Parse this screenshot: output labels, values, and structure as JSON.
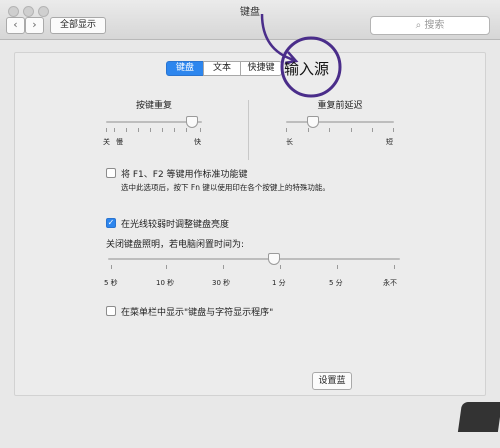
{
  "window": {
    "title": "键盘"
  },
  "toolbar": {
    "show_all": "全部显示",
    "search_placeholder": "搜索",
    "back": "‹",
    "forward": "›"
  },
  "tabs": [
    {
      "label": "键盘",
      "active": true
    },
    {
      "label": "文本",
      "active": false
    },
    {
      "label": "快捷键",
      "active": false
    }
  ],
  "annotation": {
    "text": "输入源",
    "color": "#4a2d8a"
  },
  "key_repeat": {
    "title": "按键重复",
    "min_label": "关",
    "slow_label": "慢",
    "fast_label": "快",
    "level": 0.9
  },
  "delay_until_repeat": {
    "title": "重复前延迟",
    "long_label": "长",
    "short_label": "短",
    "level": 0.25
  },
  "fn_keys": {
    "checked": false,
    "label": "将 F1、F2 等键用作标准功能键",
    "description": "选中此选项后，按下 Fn 键以使用印在各个按键上的特殊功能。"
  },
  "brightness": {
    "checked": true,
    "label": "在光线较弱时调整键盘亮度"
  },
  "backlight": {
    "title": "关闭键盘照明，若电脑闲置时间为:",
    "ticks": [
      "5 秒",
      "10 秒",
      "30 秒",
      "1 分",
      "5 分",
      "永不"
    ],
    "level": 0.57
  },
  "menu_bar": {
    "checked": false,
    "label": "在菜单栏中显示\"键盘与字符显示程序\""
  },
  "setup_button": {
    "label": "设置蓝"
  },
  "colors": {
    "accent": "#2d86ee",
    "annotation": "#4a2d8a"
  }
}
